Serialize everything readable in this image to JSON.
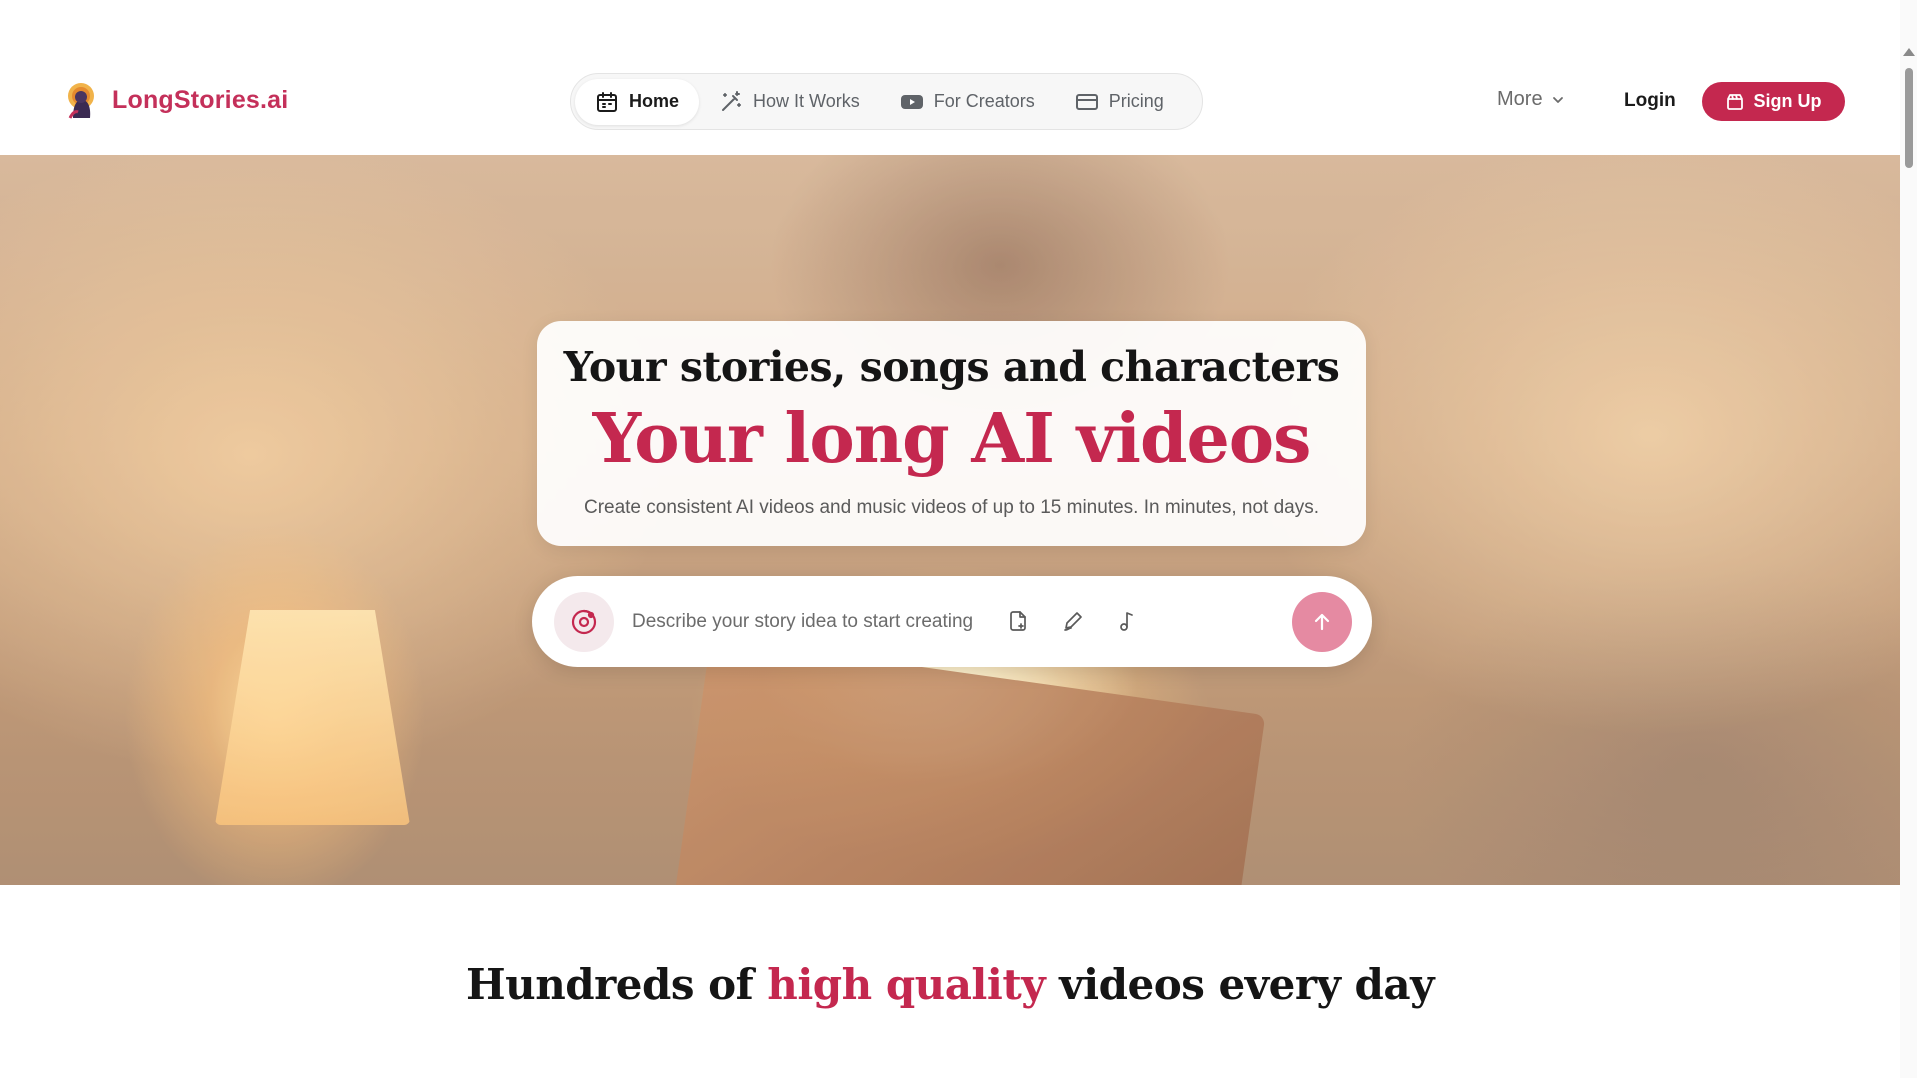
{
  "brand": {
    "name": "LongStories.ai",
    "logo_icon": "storyteller-logo-icon",
    "color": "#c4305a"
  },
  "nav": {
    "items": [
      {
        "label": "Home",
        "icon": "calendar-icon",
        "active": true
      },
      {
        "label": "How It Works",
        "icon": "magic-wand-icon",
        "active": false
      },
      {
        "label": "For Creators",
        "icon": "youtube-icon",
        "active": false
      },
      {
        "label": "Pricing",
        "icon": "credit-card-icon",
        "active": false
      }
    ]
  },
  "header_actions": {
    "more_label": "More",
    "login_label": "Login",
    "signup_label": "Sign Up",
    "signup_color": "#c4284f"
  },
  "hero": {
    "headline_top": "Your stories, songs and characters",
    "headline_main": "Your long AI videos",
    "subtitle": "Create consistent AI videos and music videos of up to 15 minutes. In minutes, not days.",
    "accent_color": "#c4284f"
  },
  "prompt": {
    "placeholder": "Describe your story idea to start creating",
    "value": "",
    "tools": [
      "document-icon",
      "pen-icon",
      "music-note-icon"
    ],
    "send_icon": "arrow-up-icon",
    "send_color": "#e58aa2"
  },
  "section": {
    "title_before": "Hundreds of ",
    "title_accent": "high quality",
    "title_after": " videos every day"
  }
}
